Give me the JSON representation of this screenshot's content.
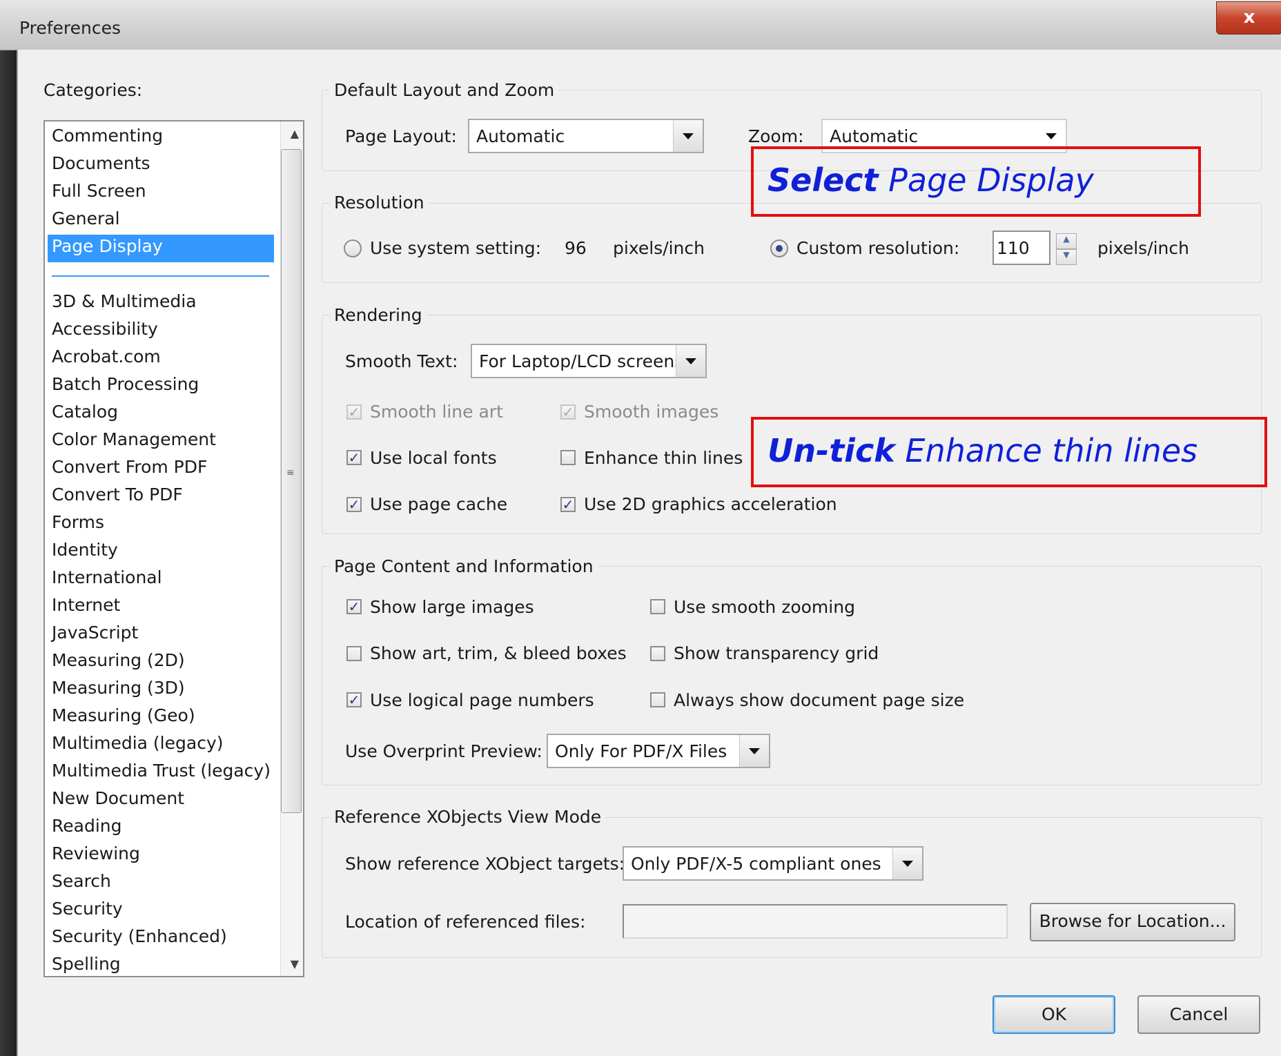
{
  "window": {
    "title": "Preferences",
    "close_label": "x"
  },
  "categories": {
    "label": "Categories:",
    "top_items": [
      "Commenting",
      "Documents",
      "Full Screen",
      "General",
      "Page Display"
    ],
    "selected": "Page Display",
    "items": [
      "3D & Multimedia",
      "Accessibility",
      "Acrobat.com",
      "Batch Processing",
      "Catalog",
      "Color Management",
      "Convert From PDF",
      "Convert To PDF",
      "Forms",
      "Identity",
      "International",
      "Internet",
      "JavaScript",
      "Measuring (2D)",
      "Measuring (3D)",
      "Measuring (Geo)",
      "Multimedia (legacy)",
      "Multimedia Trust (legacy)",
      "New Document",
      "Reading",
      "Reviewing",
      "Search",
      "Security",
      "Security (Enhanced)",
      "Spelling"
    ]
  },
  "layout_zoom": {
    "title": "Default Layout and Zoom",
    "page_layout_label": "Page Layout:",
    "page_layout_value": "Automatic",
    "zoom_label": "Zoom:",
    "zoom_value": "Automatic"
  },
  "resolution": {
    "title": "Resolution",
    "system_label": "Use system setting:",
    "system_value": "96",
    "system_unit": "pixels/inch",
    "custom_label": "Custom resolution:",
    "custom_value": "110",
    "custom_unit": "pixels/inch",
    "selected": "custom"
  },
  "rendering": {
    "title": "Rendering",
    "smooth_text_label": "Smooth Text:",
    "smooth_text_value": "For Laptop/LCD screens",
    "smooth_line_art": "Smooth line art",
    "smooth_images": "Smooth images",
    "use_local_fonts": "Use local fonts",
    "enhance_thin_lines": "Enhance thin lines",
    "use_page_cache": "Use page cache",
    "use_2d_accel": "Use 2D graphics acceleration",
    "checked": {
      "smooth_line_art": true,
      "smooth_images": true,
      "use_local_fonts": true,
      "enhance_thin_lines": false,
      "use_page_cache": true,
      "use_2d_accel": true
    }
  },
  "page_content": {
    "title": "Page Content and Information",
    "show_large_images": "Show large images",
    "use_smooth_zooming": "Use smooth zooming",
    "show_art_trim": "Show art, trim, & bleed boxes",
    "show_transparency_grid": "Show transparency grid",
    "use_logical_page_numbers": "Use logical page numbers",
    "always_show_page_size": "Always show document page size",
    "overprint_label": "Use Overprint Preview:",
    "overprint_value": "Only For PDF/X Files",
    "checked": {
      "show_large_images": true,
      "use_smooth_zooming": false,
      "show_art_trim": false,
      "show_transparency_grid": false,
      "use_logical_page_numbers": true,
      "always_show_page_size": false
    }
  },
  "xobjects": {
    "title": "Reference XObjects View Mode",
    "targets_label": "Show reference XObject targets:",
    "targets_value": "Only PDF/X-5 compliant ones",
    "location_label": "Location of referenced files:",
    "location_value": "",
    "browse_label": "Browse for Location..."
  },
  "buttons": {
    "ok": "OK",
    "cancel": "Cancel"
  },
  "annotations": {
    "select_bold": "Select",
    "select_rest": " Page Display",
    "untick_bold": "Un-tick",
    "untick_rest": " Enhance thin lines",
    "color": "#e01010",
    "text_color": "#1020d8"
  },
  "colors": {
    "selection": "#3399ff",
    "dialog_bg": "#f0f0f0"
  }
}
